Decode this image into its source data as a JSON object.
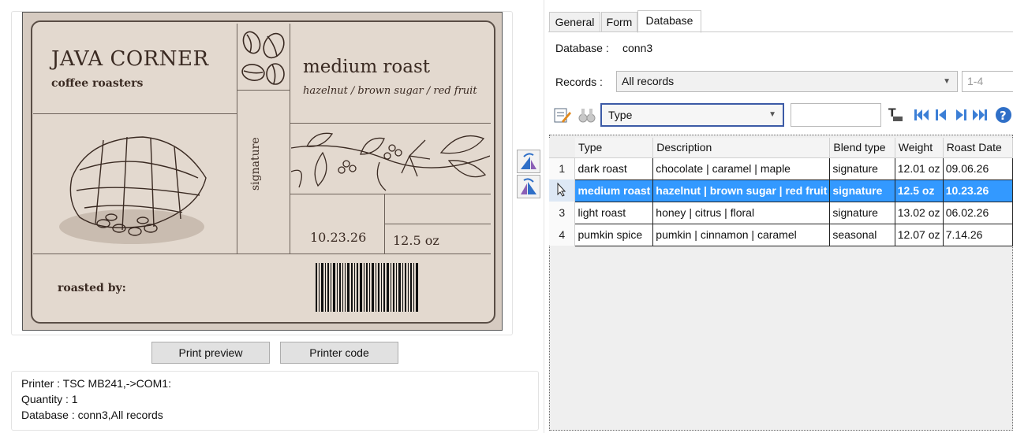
{
  "label": {
    "brand_name": "JAVA CORNER",
    "brand_sub": "coffee roasters",
    "product_name": "medium roast",
    "flavor_notes": "hazelnut / brown sugar / red fruit",
    "tag": "signature",
    "roast_date": "10.23.26",
    "net_weight": "12.5 oz",
    "roasted_by": "roasted by:"
  },
  "buttons": {
    "print_preview": "Print preview",
    "printer_code": "Printer code"
  },
  "info": {
    "printer": "Printer : TSC MB241,->COM1:",
    "quantity": "Quantity : 1",
    "database": "Database : conn3,All records"
  },
  "tabs": [
    "General",
    "Form",
    "Database"
  ],
  "database_tab": {
    "database_label": "Database :",
    "database_value": "conn3",
    "records_label": "Records :",
    "records_value": "All records",
    "records_range": "1-4",
    "field_select": "Type"
  },
  "table": {
    "columns": [
      "Type",
      "Description",
      "Blend type",
      "Weight",
      "Roast Date"
    ],
    "rows": [
      {
        "n": "1",
        "type": "dark roast",
        "description": "chocolate | caramel | maple",
        "blend": "signature",
        "weight": "12.01 oz",
        "date": "09.06.26"
      },
      {
        "n": "",
        "type": "medium roast",
        "description": "hazelnut | brown sugar | red fruit",
        "blend": "signature",
        "weight": "12.5 oz",
        "date": "10.23.26"
      },
      {
        "n": "3",
        "type": "light roast",
        "description": "honey | citrus | floral",
        "blend": "signature",
        "weight": "13.02 oz",
        "date": "06.02.26"
      },
      {
        "n": "4",
        "type": "pumkin spice",
        "description": "pumkin | cinnamon | caramel",
        "blend": "seasonal",
        "weight": "12.07 oz",
        "date": "7.14.26"
      }
    ],
    "selected_row": 2
  },
  "colors": {
    "selection": "#3399ff",
    "label_bg": "#e3d9cf",
    "toolbar_blue": "#3c7fd6"
  }
}
